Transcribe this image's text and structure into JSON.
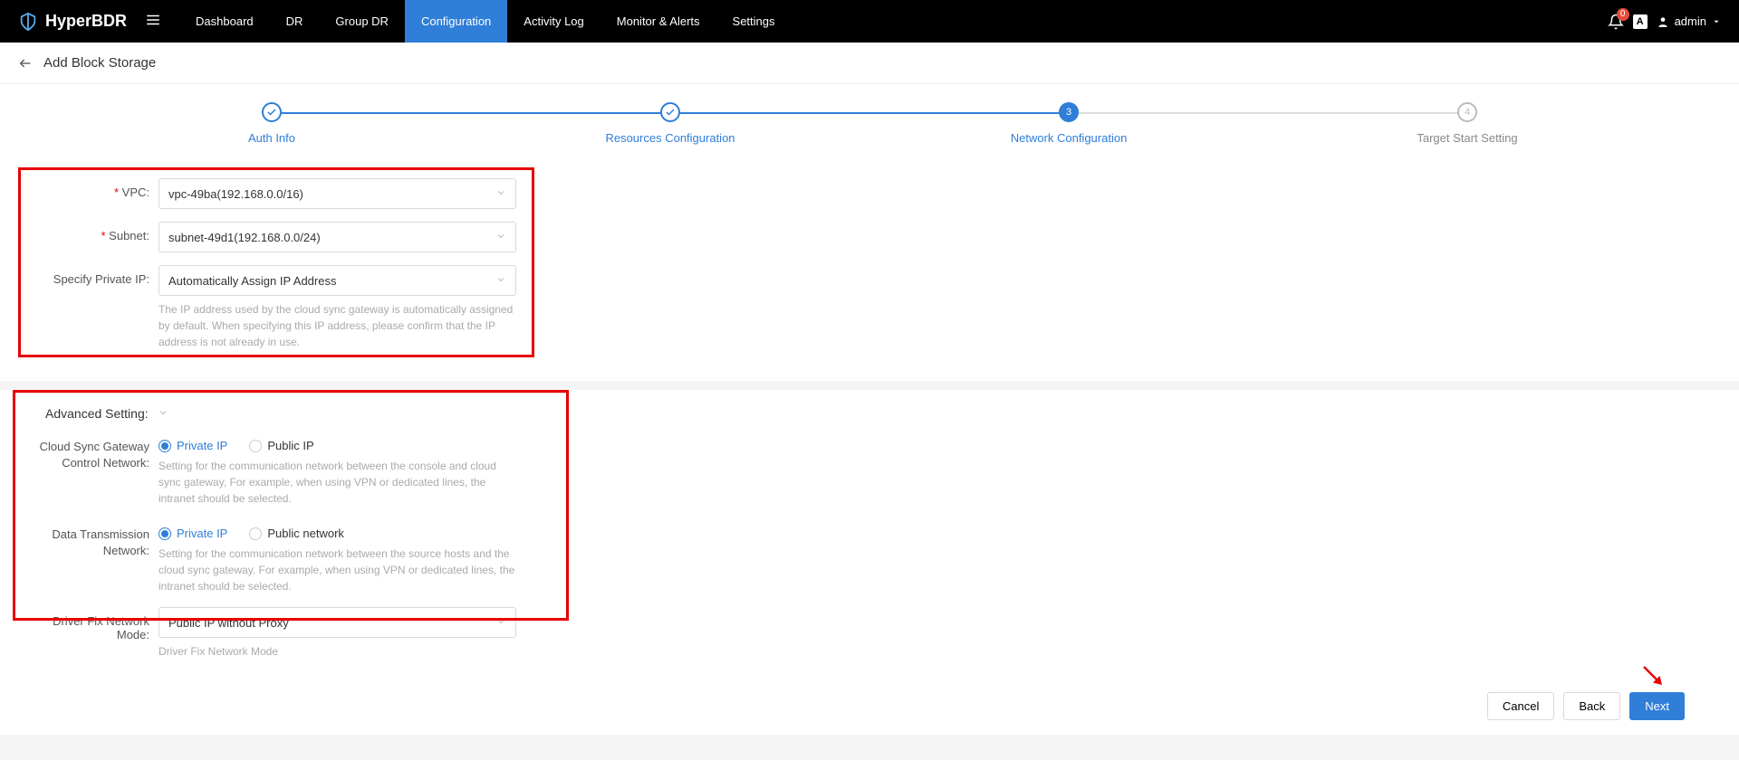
{
  "brand": "HyperBDR",
  "nav": {
    "items": [
      "Dashboard",
      "DR",
      "Group DR",
      "Configuration",
      "Activity Log",
      "Monitor & Alerts",
      "Settings"
    ],
    "activeIndex": 3,
    "alertBadge": "0",
    "langCode": "A",
    "username": "admin"
  },
  "page": {
    "title": "Add Block Storage"
  },
  "stepper": {
    "steps": [
      {
        "label": "Auth Info",
        "state": "done",
        "icon": "check"
      },
      {
        "label": "Resources Configuration",
        "state": "done",
        "icon": "check"
      },
      {
        "label": "Network Configuration",
        "state": "current",
        "num": "3"
      },
      {
        "label": "Target Start Setting",
        "state": "upcoming",
        "num": "4"
      }
    ]
  },
  "form": {
    "vpc": {
      "label": "VPC:",
      "value": "vpc-49ba(192.168.0.0/16)"
    },
    "subnet": {
      "label": "Subnet:",
      "value": "subnet-49d1(192.168.0.0/24)"
    },
    "privateIp": {
      "label": "Specify Private IP:",
      "value": "Automatically Assign IP Address",
      "help": "The IP address used by the cloud sync gateway is automatically assigned by default. When specifying this IP address, please confirm that the IP address is not already in use."
    }
  },
  "advanced": {
    "title": "Advanced Setting:",
    "cloudSync": {
      "label": "Cloud Sync Gateway Control Network:",
      "options": [
        "Private IP",
        "Public IP"
      ],
      "selectedIndex": 0,
      "help": "Setting for the communication network between the console and cloud sync gateway, For example, when using VPN or dedicated lines, the intranet should be selected."
    },
    "dataTrans": {
      "label": "Data Transmission Network:",
      "options": [
        "Private IP",
        "Public network"
      ],
      "selectedIndex": 0,
      "help": "Setting for the communication network between the source hosts and the cloud sync gateway. For example, when using VPN or dedicated lines, the intranet should be selected."
    },
    "driverFix": {
      "label": "Driver Fix Network Mode:",
      "value": "Public IP without Proxy",
      "help": "Driver Fix Network Mode"
    }
  },
  "footer": {
    "cancel": "Cancel",
    "back": "Back",
    "next": "Next"
  }
}
